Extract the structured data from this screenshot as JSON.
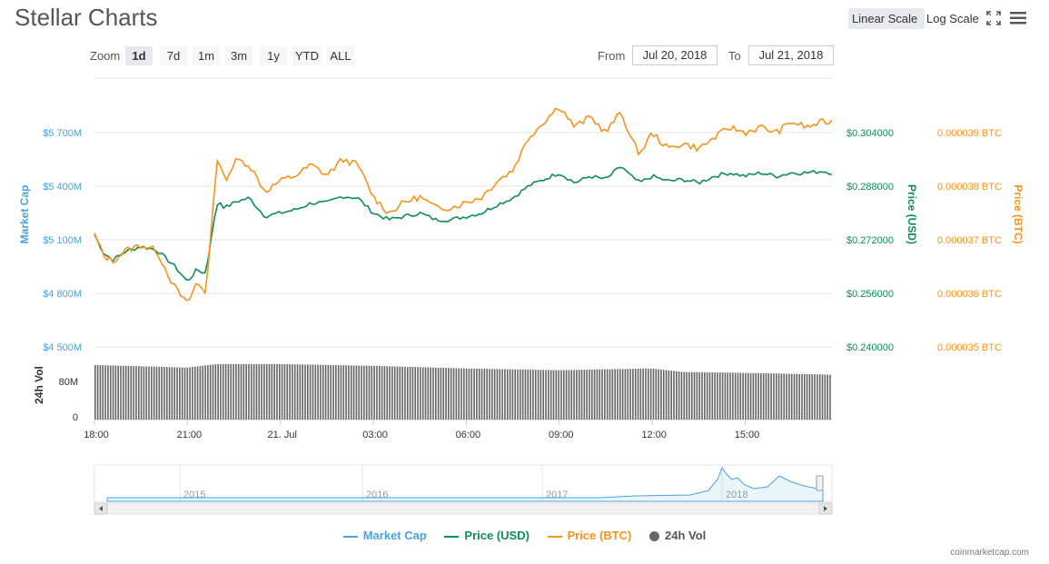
{
  "header": {
    "title": "Stellar Charts",
    "linear_scale_label": "Linear Scale",
    "log_scale_label": "Log Scale"
  },
  "zoom": {
    "label": "Zoom",
    "buttons": [
      "1d",
      "7d",
      "1m",
      "3m",
      "1y",
      "YTD",
      "ALL"
    ],
    "active": "1d"
  },
  "range": {
    "from_label": "From",
    "from_value": "Jul 20, 2018",
    "to_label": "To",
    "to_value": "Jul 21, 2018"
  },
  "legend": {
    "market_cap": "Market Cap",
    "price_usd": "Price (USD)",
    "price_btc": "Price (BTC)",
    "vol": "24h Vol"
  },
  "credit": "coinmarketcap.com",
  "colors": {
    "market_cap": "#4aa3df",
    "price_usd": "#0e8a5f",
    "price_btc": "#f7931a",
    "volume": "#666666"
  },
  "chart_data": {
    "type": "line",
    "x_axis": {
      "tick_labels": [
        "18:00",
        "21:00",
        "21. Jul",
        "03:00",
        "06:00",
        "09:00",
        "12:00",
        "15:00"
      ],
      "tick_hours": [
        0,
        3,
        6,
        9,
        12,
        15,
        18,
        21
      ],
      "range_hours": [
        0,
        23.8
      ]
    },
    "axes": {
      "market_cap": {
        "label": "Market Cap",
        "ticks": [
          "$4 500M",
          "$4 800M",
          "$5 100M",
          "$5 400M",
          "$5 700M"
        ],
        "range": [
          4500,
          5850
        ]
      },
      "price_usd": {
        "label": "Price (USD)",
        "ticks": [
          "$0.240000",
          "$0.256000",
          "$0.272000",
          "$0.288000",
          "$0.304000"
        ],
        "range": [
          0.24,
          0.32
        ]
      },
      "price_btc": {
        "label": "Price (BTC)",
        "ticks": [
          "0.000035 BTC",
          "0.000036 BTC",
          "0.000037 BTC",
          "0.000038 BTC",
          "0.000039 BTC"
        ],
        "range": [
          3.5e-05,
          3.95e-05
        ]
      },
      "volume": {
        "label": "24h Vol",
        "ticks": [
          "0",
          "80M"
        ],
        "range": [
          0,
          136
        ]
      }
    },
    "series": [
      {
        "name": "Price (USD)",
        "key": "price_usd",
        "hours": [
          0,
          0.3,
          0.6,
          1.0,
          1.5,
          2.0,
          2.6,
          3.0,
          3.3,
          3.6,
          3.8,
          4.0,
          4.2,
          4.6,
          5.0,
          5.5,
          6.0,
          6.5,
          7.0,
          7.5,
          8.0,
          8.5,
          9.0,
          9.5,
          10.0,
          10.5,
          11.0,
          11.5,
          12.0,
          12.5,
          13.0,
          13.5,
          14.0,
          14.5,
          15.0,
          15.5,
          16.0,
          16.5,
          17.0,
          17.3,
          17.6,
          18.0,
          18.5,
          19.0,
          19.5,
          20.0,
          20.5,
          21.0,
          21.5,
          22.0,
          22.5,
          23.0,
          23.5,
          23.8
        ],
        "values": [
          0.2735,
          0.268,
          0.266,
          0.2685,
          0.27,
          0.269,
          0.264,
          0.2595,
          0.263,
          0.262,
          0.275,
          0.284,
          0.2815,
          0.2835,
          0.2845,
          0.279,
          0.28,
          0.281,
          0.283,
          0.283,
          0.285,
          0.2845,
          0.28,
          0.278,
          0.279,
          0.28,
          0.278,
          0.278,
          0.279,
          0.28,
          0.2825,
          0.2845,
          0.288,
          0.29,
          0.292,
          0.289,
          0.291,
          0.29,
          0.294,
          0.291,
          0.289,
          0.291,
          0.2895,
          0.29,
          0.289,
          0.291,
          0.292,
          0.291,
          0.292,
          0.291,
          0.292,
          0.292,
          0.2925,
          0.292
        ]
      },
      {
        "name": "Price (BTC)",
        "key": "price_btc",
        "hours": [
          0,
          0.3,
          0.6,
          1.0,
          1.5,
          2.0,
          2.6,
          3.0,
          3.3,
          3.6,
          3.8,
          4.0,
          4.2,
          4.6,
          5.0,
          5.5,
          6.0,
          6.5,
          7.0,
          7.5,
          8.0,
          8.5,
          9.0,
          9.5,
          10.0,
          10.5,
          11.0,
          11.5,
          12.0,
          12.5,
          13.0,
          13.5,
          14.0,
          14.5,
          15.0,
          15.5,
          16.0,
          16.5,
          17.0,
          17.3,
          17.6,
          18.0,
          18.5,
          19.0,
          19.5,
          20.0,
          20.5,
          21.0,
          21.5,
          22.0,
          22.5,
          23.0,
          23.5,
          23.8
        ],
        "values": [
          3.71e-05,
          3.67e-05,
          3.66e-05,
          3.68e-05,
          3.69e-05,
          3.68e-05,
          3.61e-05,
          3.58e-05,
          3.62e-05,
          3.6e-05,
          3.75e-05,
          3.86e-05,
          3.81e-05,
          3.85e-05,
          3.84e-05,
          3.79e-05,
          3.81e-05,
          3.82e-05,
          3.84e-05,
          3.82e-05,
          3.85e-05,
          3.84e-05,
          3.78e-05,
          3.75e-05,
          3.77e-05,
          3.78e-05,
          3.76e-05,
          3.76e-05,
          3.77e-05,
          3.78e-05,
          3.81e-05,
          3.83e-05,
          3.89e-05,
          3.92e-05,
          3.95e-05,
          3.91e-05,
          3.93e-05,
          3.9e-05,
          3.94e-05,
          3.89e-05,
          3.86e-05,
          3.9e-05,
          3.87e-05,
          3.88e-05,
          3.87e-05,
          3.89e-05,
          3.91e-05,
          3.9e-05,
          3.91e-05,
          3.9e-05,
          3.92e-05,
          3.91e-05,
          3.92e-05,
          3.92e-05
        ]
      },
      {
        "name": "24h Vol",
        "key": "volume",
        "type": "bar",
        "hours": [
          0,
          3,
          4,
          6,
          9,
          12,
          15,
          18,
          19,
          21,
          23.8
        ],
        "values": [
          124,
          118,
          126,
          126,
          122,
          116,
          112,
          116,
          108,
          106,
          102
        ]
      }
    ],
    "grid": true,
    "legend_position": "bottom"
  },
  "navigator": {
    "year_labels": [
      "2015",
      "2016",
      "2017",
      "2018"
    ]
  }
}
